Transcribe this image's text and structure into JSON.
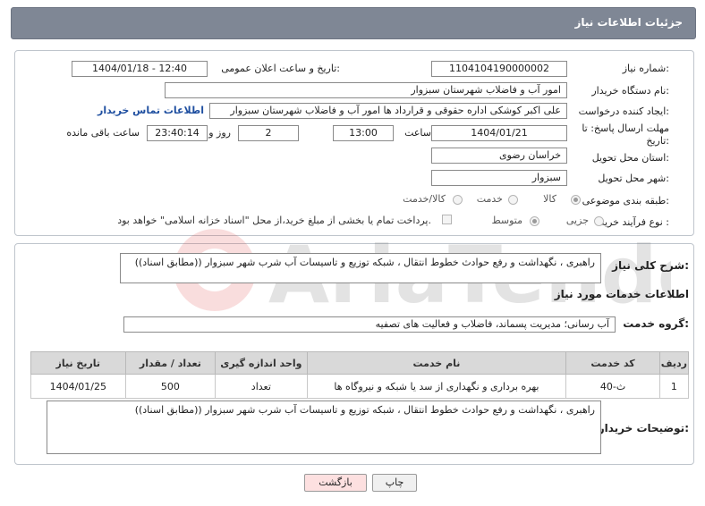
{
  "header": {
    "title": "جزئیات اطلاعات نیاز"
  },
  "fields": {
    "need_number_label": "شماره نیاز:",
    "need_number": "1104104190000002",
    "announce_label": "تاریخ و ساعت اعلان عمومی:",
    "announce_value": "1404/01/18 - 12:40",
    "buyer_org_label": "نام دستگاه خریدار:",
    "buyer_org": "امور آب و فاضلاب شهرستان سبزوار",
    "creator_label": "ایجاد کننده درخواست:",
    "creator": "علی اکبر کوشکی اداره حقوقی و قرارداد ها امور آب و فاضلاب شهرستان سبزوار",
    "contact_link": "اطلاعات تماس خریدار",
    "deadline_label": "مهلت ارسال پاسخ: تا تاریخ:",
    "deadline_date": "1404/01/21",
    "time_label": "ساعت",
    "deadline_time": "13:00",
    "days_value": "2",
    "days_label": "روز و",
    "remaining_time": "23:40:14",
    "remaining_label": "ساعت باقی مانده",
    "province_label": "استان محل تحویل:",
    "province": "خراسان رضوی",
    "city_label": "شهر محل تحویل:",
    "city": "سبزوار",
    "category_label": "طبقه بندی موضوعی:",
    "category_options": [
      "کالا",
      "خدمت",
      "کالا/خدمت"
    ],
    "process_label": "نوع فرآیند خرید :",
    "process_options": [
      "جزیی",
      "متوسط"
    ],
    "payment_note": "پرداخت تمام یا بخشی از مبلغ خرید،از محل \"اسناد خزانه اسلامی\" خواهد بود."
  },
  "summary": {
    "label": "شرح کلی نیاز:",
    "text": "راهبری ، نگهداشت و رفع حوادث خطوط انتقال ، شبکه توزیع و تاسیسات آب شرب شهر سبزوار ((مطابق اسناد))"
  },
  "services": {
    "section_title": "اطلاعات خدمات مورد نیاز",
    "group_label": "گروه خدمت:",
    "group_value": "آب رسانی؛ مدیریت پسماند، فاضلاب و فعالیت های تصفیه",
    "columns": [
      "ردیف",
      "کد خدمت",
      "نام خدمت",
      "واحد اندازه گیری",
      "تعداد / مقدار",
      "تاریخ نیاز"
    ],
    "rows": [
      {
        "row": "1",
        "code": "ث-40",
        "name": "بهره برداری و نگهداری از سد یا شبکه و نیروگاه ها",
        "unit": "تعداد",
        "qty": "500",
        "date": "1404/01/25"
      }
    ]
  },
  "buyer_notes": {
    "label": "توضیحات خریدار:",
    "text": "راهبری ، نگهداشت و رفع حوادث خطوط انتقال ، شبکه توزیع و تاسیسات آب شرب شهر سبزوار ((مطابق اسناد))"
  },
  "buttons": {
    "print": "چاپ",
    "back": "بازگشت"
  },
  "colors": {
    "header_bg": "#7f8795",
    "link": "#1f4fa0",
    "back_button_bg": "#fde0e0"
  }
}
